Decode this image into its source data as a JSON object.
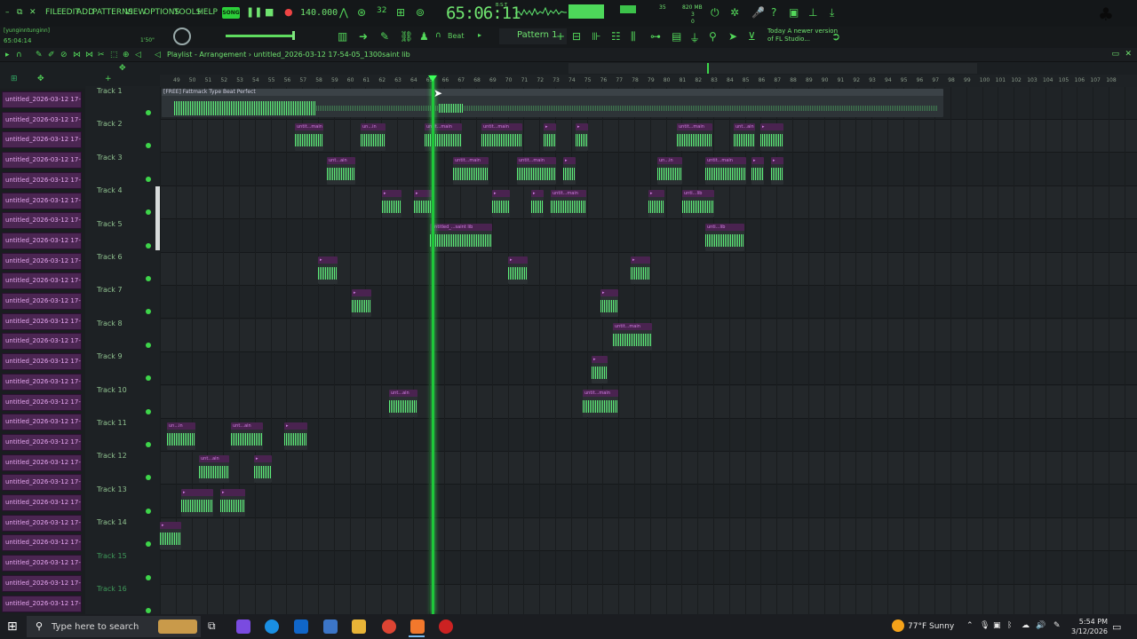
{
  "menu": {
    "items": [
      "FILE",
      "EDIT",
      "ADD",
      "PATTERNS",
      "VIEW",
      "OPTIONS",
      "TOOLS",
      "HELP"
    ],
    "song_badge": "SONG",
    "tempo": "140.000",
    "time": "65:06:11",
    "time_small": "B:S:T",
    "cpu_num": "35",
    "mem": "820 MB",
    "mem_num": "3",
    "vol_num": "0"
  },
  "subbar": {
    "user": "[yunginntunginn]",
    "user_time": "65:04:14",
    "zoom": "1'50\"",
    "snap": "Beat",
    "pattern": "Pattern 1",
    "news_title": "Today",
    "news_text": "A newer version of FL Studio..."
  },
  "playlist": {
    "title": "Playlist - Arrangement",
    "project": "untitled_2026-03-12 17-54-05_1300saint lib"
  },
  "ruler": [
    "49",
    "50",
    "51",
    "52",
    "53",
    "54",
    "55",
    "56",
    "57",
    "58",
    "59",
    "60",
    "61",
    "62",
    "63",
    "64",
    "65",
    "66",
    "67",
    "68",
    "69",
    "70",
    "71",
    "72",
    "73",
    "74",
    "75",
    "76",
    "77",
    "78",
    "79",
    "80",
    "81",
    "82",
    "83",
    "84",
    "85",
    "86",
    "87",
    "88",
    "89",
    "90",
    "91",
    "92",
    "93",
    "94",
    "95",
    "96",
    "97",
    "98",
    "99",
    "100",
    "101",
    "102",
    "103",
    "104",
    "105",
    "106",
    "107",
    "108"
  ],
  "patterns": [
    "untitled_2026-03-12 17-...",
    "untitled_2026-03-12 17-...",
    "untitled_2026-03-12 17-...",
    "untitled_2026-03-12 17-...",
    "untitled_2026-03-12 17-...",
    "untitled_2026-03-12 17-...",
    "untitled_2026-03-12 17-...",
    "untitled_2026-03-12 17-...",
    "untitled_2026-03-12 17-...",
    "untitled_2026-03-12 17-...",
    "untitled_2026-03-12 17-...",
    "untitled_2026-03-12 17-...",
    "untitled_2026-03-12 17-...",
    "untitled_2026-03-12 17-...",
    "untitled_2026-03-12 17-...",
    "untitled_2026-03-12 17-...",
    "untitled_2026-03-12 17-...",
    "untitled_2026-03-12 17-...",
    "untitled_2026-03-12 17-...",
    "untitled_2026-03-12 17-...",
    "untitled_2026-03-12 17-...",
    "untitled_2026-03-12 17-...",
    "untitled_2026-03-12 17-...",
    "untitled_2026-03-12 17-...",
    "untitled_2026-03-12 17-...",
    "untitled_2026-03-12 17-...",
    "untitled_2026-03-12 17-..."
  ],
  "tracks": [
    "Track 1",
    "Track 2",
    "Track 3",
    "Track 4",
    "Track 5",
    "Track 6",
    "Track 7",
    "Track 8",
    "Track 9",
    "Track 10",
    "Track 11",
    "Track 12",
    "Track 13",
    "Track 14",
    "Track 15",
    "Track 16"
  ],
  "clip_labels": {
    "long": "[FREE] Fattmack Type Beat Perfect",
    "saint": "untitled_...saint lib",
    "main": "untit...main",
    "ain": "unt...ain",
    "lib": "unti...lib",
    "un": "un...in"
  },
  "taskbar": {
    "search": "Type here to search",
    "weather": "77°F  Sunny",
    "time": "5:54 PM",
    "date": "3/12/2026"
  }
}
